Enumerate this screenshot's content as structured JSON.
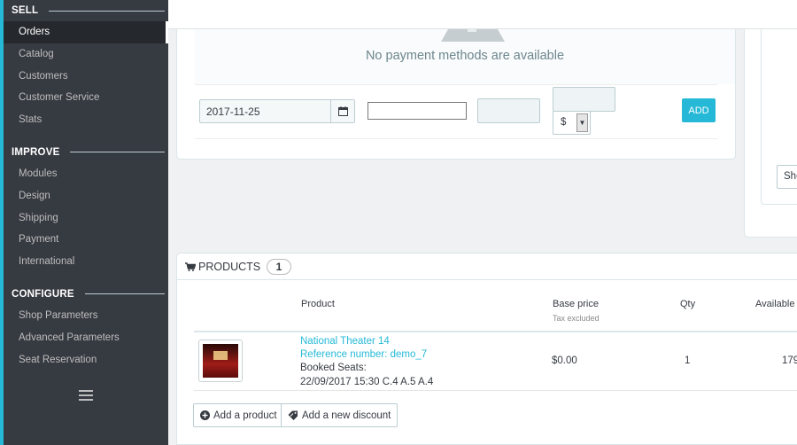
{
  "sidebar": {
    "sections": [
      {
        "title": "SELL",
        "items": [
          "Orders",
          "Catalog",
          "Customers",
          "Customer Service",
          "Stats"
        ]
      },
      {
        "title": "IMPROVE",
        "items": [
          "Modules",
          "Design",
          "Shipping",
          "Payment",
          "International"
        ]
      },
      {
        "title": "CONFIGURE",
        "items": [
          "Shop Parameters",
          "Advanced Parameters",
          "Seat Reservation"
        ]
      }
    ],
    "active_item": "Orders"
  },
  "payment": {
    "empty_message": "No payment methods are available",
    "date_value": "2017-11-25",
    "currency": "$",
    "add_label": "ADD"
  },
  "right_panel": {
    "button_label": "Sho"
  },
  "products": {
    "title": "PRODUCTS",
    "count": "1",
    "columns": {
      "product": "Product",
      "base_price": "Base price",
      "base_price_note": "Tax excluded",
      "qty": "Qty",
      "available": "Available"
    },
    "rows": [
      {
        "name": "National Theater 14",
        "reference": "Reference number: demo_7",
        "seats_label": "Booked Seats:",
        "seats_detail": "22/09/2017 15:30 C.4 A.5 A.4",
        "base_price": "$0.00",
        "qty": "1",
        "available": "179"
      }
    ],
    "add_product_label": "Add a product",
    "add_discount_label": "Add a new discount"
  },
  "colors": {
    "accent": "#25b9d7",
    "sidebar_bg": "#363a41"
  }
}
